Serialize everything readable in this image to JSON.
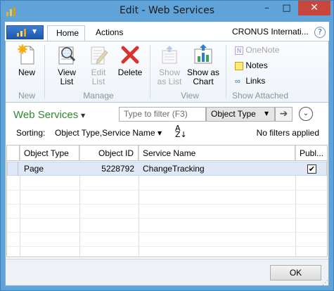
{
  "window": {
    "title": "Edit - Web Services",
    "min": "–",
    "max": "□",
    "close": "✕"
  },
  "ribbon": {
    "tabs": [
      {
        "label": "Home"
      },
      {
        "label": "Actions"
      }
    ],
    "company": "CRONUS Internati...",
    "help": "?",
    "new_group": {
      "label": "New",
      "buttons": [
        {
          "label": "New"
        }
      ]
    },
    "manage_group": {
      "label": "Manage",
      "buttons": [
        {
          "label": "View List",
          "l1": "View",
          "l2": "List"
        },
        {
          "label": "Edit List",
          "l1": "Edit",
          "l2": "List"
        },
        {
          "label": "Delete"
        }
      ]
    },
    "view_group": {
      "label": "View",
      "buttons": [
        {
          "l1": "Show",
          "l2": "as List"
        },
        {
          "l1": "Show as",
          "l2": "Chart"
        }
      ]
    },
    "attached_group": {
      "label": "Show Attached",
      "buttons": [
        {
          "label": "OneNote"
        },
        {
          "label": "Notes"
        },
        {
          "label": "Links"
        }
      ]
    }
  },
  "page": {
    "title": "Web Services"
  },
  "filter": {
    "placeholder": "Type to filter (F3)",
    "field": "Object Type"
  },
  "sorting": {
    "label": "Sorting:",
    "value": "Object Type,Service Name",
    "status": "No filters applied"
  },
  "grid": {
    "columns": [
      "Object Type",
      "Object ID",
      "Service Name",
      "Publ..."
    ],
    "rows": [
      {
        "object_type": "Page",
        "object_id": "5228792",
        "service_name": "ChangeTracking",
        "published": true
      }
    ]
  },
  "footer": {
    "ok": "OK"
  },
  "colors": {
    "frame": "#5fa3d9",
    "close": "#c7463d",
    "title_green": "#2f8a2f",
    "selection": "#dfe9f6"
  }
}
